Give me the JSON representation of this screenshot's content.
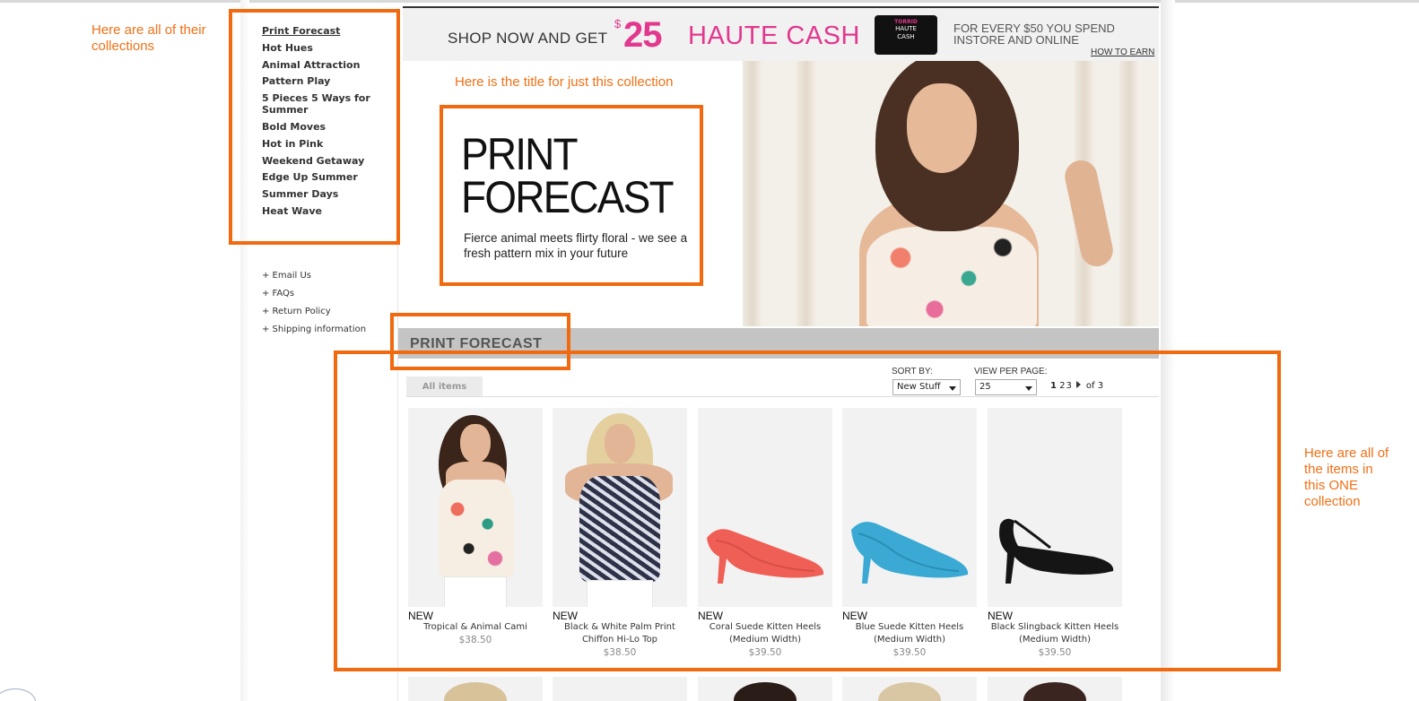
{
  "annotations": {
    "collections_note": "Here are all of their collections",
    "title_note": "Here is the title for just this collection",
    "items_note": "Here are all of the items in this ONE collection"
  },
  "sidebar": {
    "collections": [
      "Print Forecast",
      "Hot Hues",
      "Animal Attraction",
      "Pattern Play",
      "5 Pieces 5 Ways for Summer",
      "Bold Moves",
      "Hot in Pink",
      "Weekend Getaway",
      "Edge Up Summer",
      "Summer Days",
      "Heat Wave"
    ],
    "help_links": [
      "+ Email Us",
      "+ FAQs",
      "+ Return Policy",
      "+ Shipping information"
    ]
  },
  "banner": {
    "shop_now": "SHOP NOW AND GET",
    "currency": "$",
    "amount": "25",
    "haute_cash": "HAUTE CASH",
    "card_brand": "TORRID",
    "card_line1": "HAUTE",
    "card_line2": "CASH",
    "earn_text": "FOR EVERY $50 YOU SPEND INSTORE AND ONLINE",
    "how_to_earn": "HOW TO EARN"
  },
  "hero": {
    "title_line1": "PRINT",
    "title_line2": "FORECAST",
    "subtitle": "Fierce animal meets flirty floral - we see a fresh pattern mix in your future"
  },
  "collection": {
    "header": "PRINT FORECAST",
    "tab_all": "All items",
    "sort_by_label": "SORT BY:",
    "sort_by_value": "New Stuff",
    "view_per_page_label": "VIEW PER PAGE:",
    "view_per_page_value": "25",
    "pages": [
      "1",
      "2",
      "3"
    ],
    "pages_total": "of 3"
  },
  "products": [
    {
      "badge": "NEW",
      "name": "Tropical & Animal Cami",
      "price": "$38.50"
    },
    {
      "badge": "NEW",
      "name": "Black & White Palm Print Chiffon Hi-Lo Top",
      "price": "$38.50"
    },
    {
      "badge": "NEW",
      "name": "Coral Suede Kitten Heels (Medium Width)",
      "price": "$39.50"
    },
    {
      "badge": "NEW",
      "name": "Blue Suede Kitten Heels (Medium Width)",
      "price": "$39.50"
    },
    {
      "badge": "NEW",
      "name": "Black Slingback Kitten Heels (Medium Width)",
      "price": "$39.50"
    }
  ],
  "colors": {
    "annotation_orange": "#f26a10",
    "brand_pink": "#e2388e",
    "coral_shoe": "#ef5f55",
    "blue_shoe": "#3aaad4",
    "black_shoe": "#151515"
  }
}
